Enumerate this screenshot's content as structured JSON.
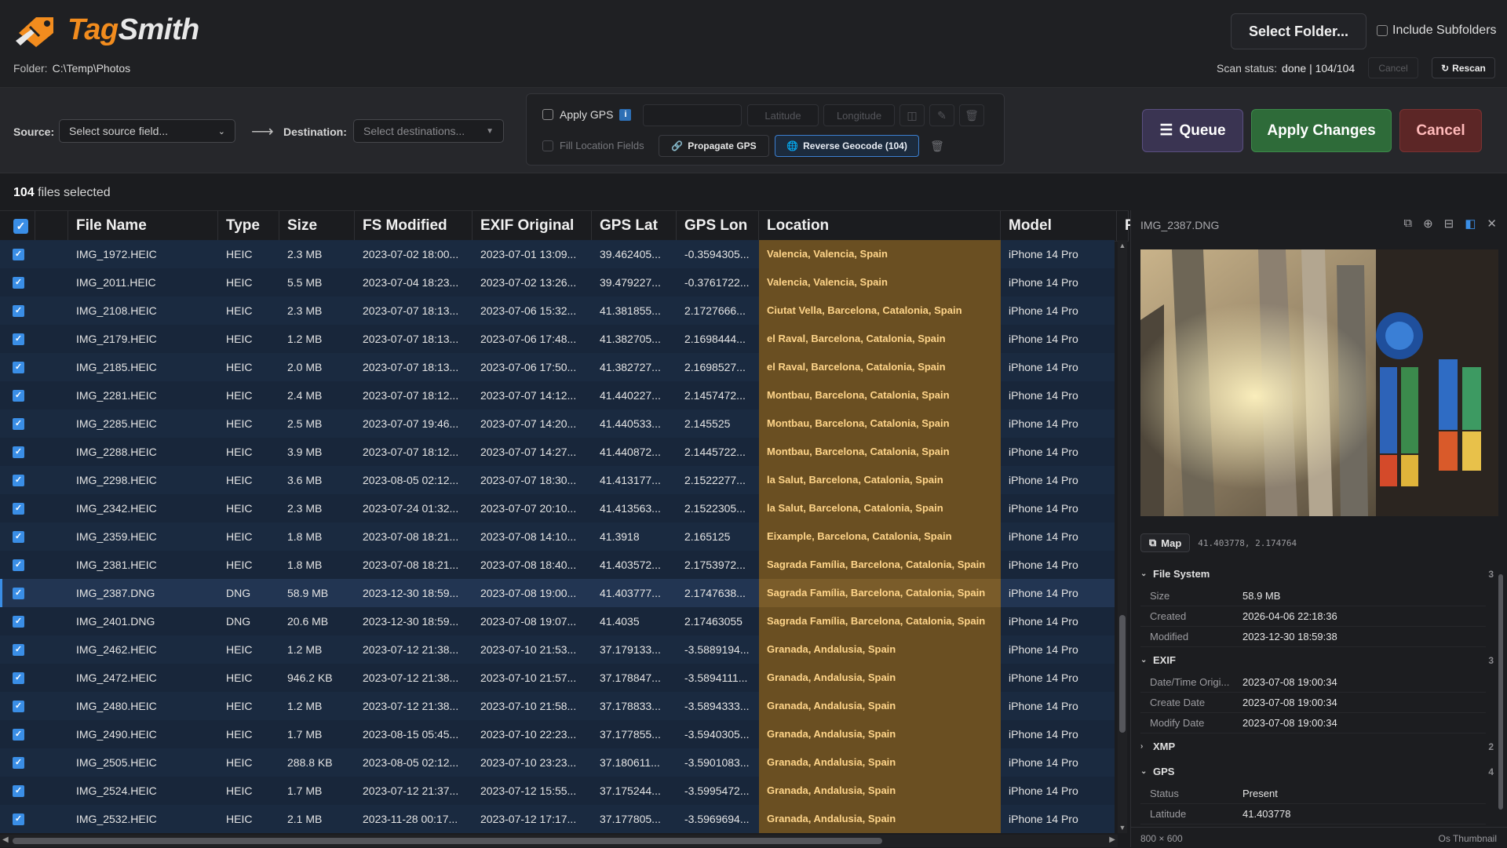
{
  "app": {
    "name_part1": "Tag",
    "name_part2": "Smith"
  },
  "folder": {
    "label": "Folder:",
    "path": "C:\\Temp\\Photos"
  },
  "top": {
    "select_folder": "Select Folder...",
    "include_subfolders": "Include Subfolders",
    "scan_status_label": "Scan status:",
    "scan_status_value": "done | 104/104",
    "cancel": "Cancel",
    "rescan": "Rescan"
  },
  "toolbar": {
    "source_label": "Source:",
    "source_placeholder": "Select source field...",
    "destination_label": "Destination:",
    "destination_placeholder": "Select destinations...",
    "apply_gps": "Apply GPS",
    "info": "i",
    "latitude": "Latitude",
    "longitude": "Longitude",
    "fill_location": "Fill Location Fields",
    "propagate_gps": "Propagate GPS",
    "reverse_geocode": "Reverse Geocode (104)",
    "queue": "Queue",
    "apply_changes": "Apply Changes",
    "cancel": "Cancel"
  },
  "selection": {
    "count": "104",
    "text": "files selected"
  },
  "table": {
    "headers": [
      "File Name",
      "Type",
      "Size",
      "FS Modified",
      "EXIF Original",
      "GPS Lat",
      "GPS Lon",
      "Location",
      "Model",
      "F"
    ],
    "rows": [
      [
        "IMG_1972.HEIC",
        "HEIC",
        "2.3 MB",
        "2023-07-02 18:00...",
        "2023-07-01 13:09...",
        "39.462405...",
        "-0.3594305...",
        "Valencia, Valencia, Spain",
        "iPhone 14 Pro"
      ],
      [
        "IMG_2011.HEIC",
        "HEIC",
        "5.5 MB",
        "2023-07-04 18:23...",
        "2023-07-02 13:26...",
        "39.479227...",
        "-0.3761722...",
        "Valencia, Valencia, Spain",
        "iPhone 14 Pro"
      ],
      [
        "IMG_2108.HEIC",
        "HEIC",
        "2.3 MB",
        "2023-07-07 18:13...",
        "2023-07-06 15:32...",
        "41.381855...",
        "2.1727666...",
        "Ciutat Vella, Barcelona, Catalonia, Spain",
        "iPhone 14 Pro"
      ],
      [
        "IMG_2179.HEIC",
        "HEIC",
        "1.2 MB",
        "2023-07-07 18:13...",
        "2023-07-06 17:48...",
        "41.382705...",
        "2.1698444...",
        "el Raval, Barcelona, Catalonia, Spain",
        "iPhone 14 Pro"
      ],
      [
        "IMG_2185.HEIC",
        "HEIC",
        "2.0 MB",
        "2023-07-07 18:13...",
        "2023-07-06 17:50...",
        "41.382727...",
        "2.1698527...",
        "el Raval, Barcelona, Catalonia, Spain",
        "iPhone 14 Pro"
      ],
      [
        "IMG_2281.HEIC",
        "HEIC",
        "2.4 MB",
        "2023-07-07 18:12...",
        "2023-07-07 14:12...",
        "41.440227...",
        "2.1457472...",
        "Montbau, Barcelona, Catalonia, Spain",
        "iPhone 14 Pro"
      ],
      [
        "IMG_2285.HEIC",
        "HEIC",
        "2.5 MB",
        "2023-07-07 19:46...",
        "2023-07-07 14:20...",
        "41.440533...",
        "2.145525",
        "Montbau, Barcelona, Catalonia, Spain",
        "iPhone 14 Pro"
      ],
      [
        "IMG_2288.HEIC",
        "HEIC",
        "3.9 MB",
        "2023-07-07 18:12...",
        "2023-07-07 14:27...",
        "41.440872...",
        "2.1445722...",
        "Montbau, Barcelona, Catalonia, Spain",
        "iPhone 14 Pro"
      ],
      [
        "IMG_2298.HEIC",
        "HEIC",
        "3.6 MB",
        "2023-08-05 02:12...",
        "2023-07-07 18:30...",
        "41.413177...",
        "2.1522277...",
        "la Salut, Barcelona, Catalonia, Spain",
        "iPhone 14 Pro"
      ],
      [
        "IMG_2342.HEIC",
        "HEIC",
        "2.3 MB",
        "2023-07-24 01:32...",
        "2023-07-07 20:10...",
        "41.413563...",
        "2.1522305...",
        "la Salut, Barcelona, Catalonia, Spain",
        "iPhone 14 Pro"
      ],
      [
        "IMG_2359.HEIC",
        "HEIC",
        "1.8 MB",
        "2023-07-08 18:21...",
        "2023-07-08 14:10...",
        "41.3918",
        "2.165125",
        "Eixample, Barcelona, Catalonia, Spain",
        "iPhone 14 Pro"
      ],
      [
        "IMG_2381.HEIC",
        "HEIC",
        "1.8 MB",
        "2023-07-08 18:21...",
        "2023-07-08 18:40...",
        "41.403572...",
        "2.1753972...",
        "Sagrada Família, Barcelona, Catalonia, Spain",
        "iPhone 14 Pro"
      ],
      [
        "IMG_2387.DNG",
        "DNG",
        "58.9 MB",
        "2023-12-30 18:59...",
        "2023-07-08 19:00...",
        "41.403777...",
        "2.1747638...",
        "Sagrada Família, Barcelona, Catalonia, Spain",
        "iPhone 14 Pro"
      ],
      [
        "IMG_2401.DNG",
        "DNG",
        "20.6 MB",
        "2023-12-30 18:59...",
        "2023-07-08 19:07...",
        "41.4035",
        "2.17463055",
        "Sagrada Família, Barcelona, Catalonia, Spain",
        "iPhone 14 Pro"
      ],
      [
        "IMG_2462.HEIC",
        "HEIC",
        "1.2 MB",
        "2023-07-12 21:38...",
        "2023-07-10 21:53...",
        "37.179133...",
        "-3.5889194...",
        "Granada, Andalusia, Spain",
        "iPhone 14 Pro"
      ],
      [
        "IMG_2472.HEIC",
        "HEIC",
        "946.2 KB",
        "2023-07-12 21:38...",
        "2023-07-10 21:57...",
        "37.178847...",
        "-3.5894111...",
        "Granada, Andalusia, Spain",
        "iPhone 14 Pro"
      ],
      [
        "IMG_2480.HEIC",
        "HEIC",
        "1.2 MB",
        "2023-07-12 21:38...",
        "2023-07-10 21:58...",
        "37.178833...",
        "-3.5894333...",
        "Granada, Andalusia, Spain",
        "iPhone 14 Pro"
      ],
      [
        "IMG_2490.HEIC",
        "HEIC",
        "1.7 MB",
        "2023-08-15 05:45...",
        "2023-07-10 22:23...",
        "37.177855...",
        "-3.5940305...",
        "Granada, Andalusia, Spain",
        "iPhone 14 Pro"
      ],
      [
        "IMG_2505.HEIC",
        "HEIC",
        "288.8 KB",
        "2023-08-05 02:12...",
        "2023-07-10 23:23...",
        "37.180611...",
        "-3.5901083...",
        "Granada, Andalusia, Spain",
        "iPhone 14 Pro"
      ],
      [
        "IMG_2524.HEIC",
        "HEIC",
        "1.7 MB",
        "2023-07-12 21:37...",
        "2023-07-12 15:55...",
        "37.175244...",
        "-3.5995472...",
        "Granada, Andalusia, Spain",
        "iPhone 14 Pro"
      ],
      [
        "IMG_2532.HEIC",
        "HEIC",
        "2.1 MB",
        "2023-11-28 00:17...",
        "2023-07-12 17:17...",
        "37.177805...",
        "-3.5969694...",
        "Granada, Andalusia, Spain",
        "iPhone 14 Pro"
      ]
    ],
    "selected_row_index": 12
  },
  "preview": {
    "title": "IMG_2387.DNG",
    "map_button": "Map",
    "coords": "41.403778, 2.174764",
    "sections": [
      {
        "name": "File System",
        "count": "3",
        "expanded": true,
        "props": [
          [
            "Size",
            "58.9 MB"
          ],
          [
            "Created",
            "2026-04-06 22:18:36"
          ],
          [
            "Modified",
            "2023-12-30 18:59:38"
          ]
        ]
      },
      {
        "name": "EXIF",
        "count": "3",
        "expanded": true,
        "props": [
          [
            "Date/Time Origi...",
            "2023-07-08 19:00:34"
          ],
          [
            "Create Date",
            "2023-07-08 19:00:34"
          ],
          [
            "Modify Date",
            "2023-07-08 19:00:34"
          ]
        ]
      },
      {
        "name": "XMP",
        "count": "2",
        "expanded": false,
        "props": []
      },
      {
        "name": "GPS",
        "count": "4",
        "expanded": true,
        "props": [
          [
            "Status",
            "Present"
          ],
          [
            "Latitude",
            "41.403778"
          ]
        ]
      }
    ],
    "dimensions": "800 × 600",
    "thumb_source": "Os Thumbnail"
  },
  "colors": {
    "accent": "#3a8ee6",
    "location_bg": "#6a4f22",
    "location_text": "#ffd58a",
    "apply_green": "#2e6b39",
    "cancel_red": "#5c2626",
    "queue_purple": "#3a3452"
  }
}
